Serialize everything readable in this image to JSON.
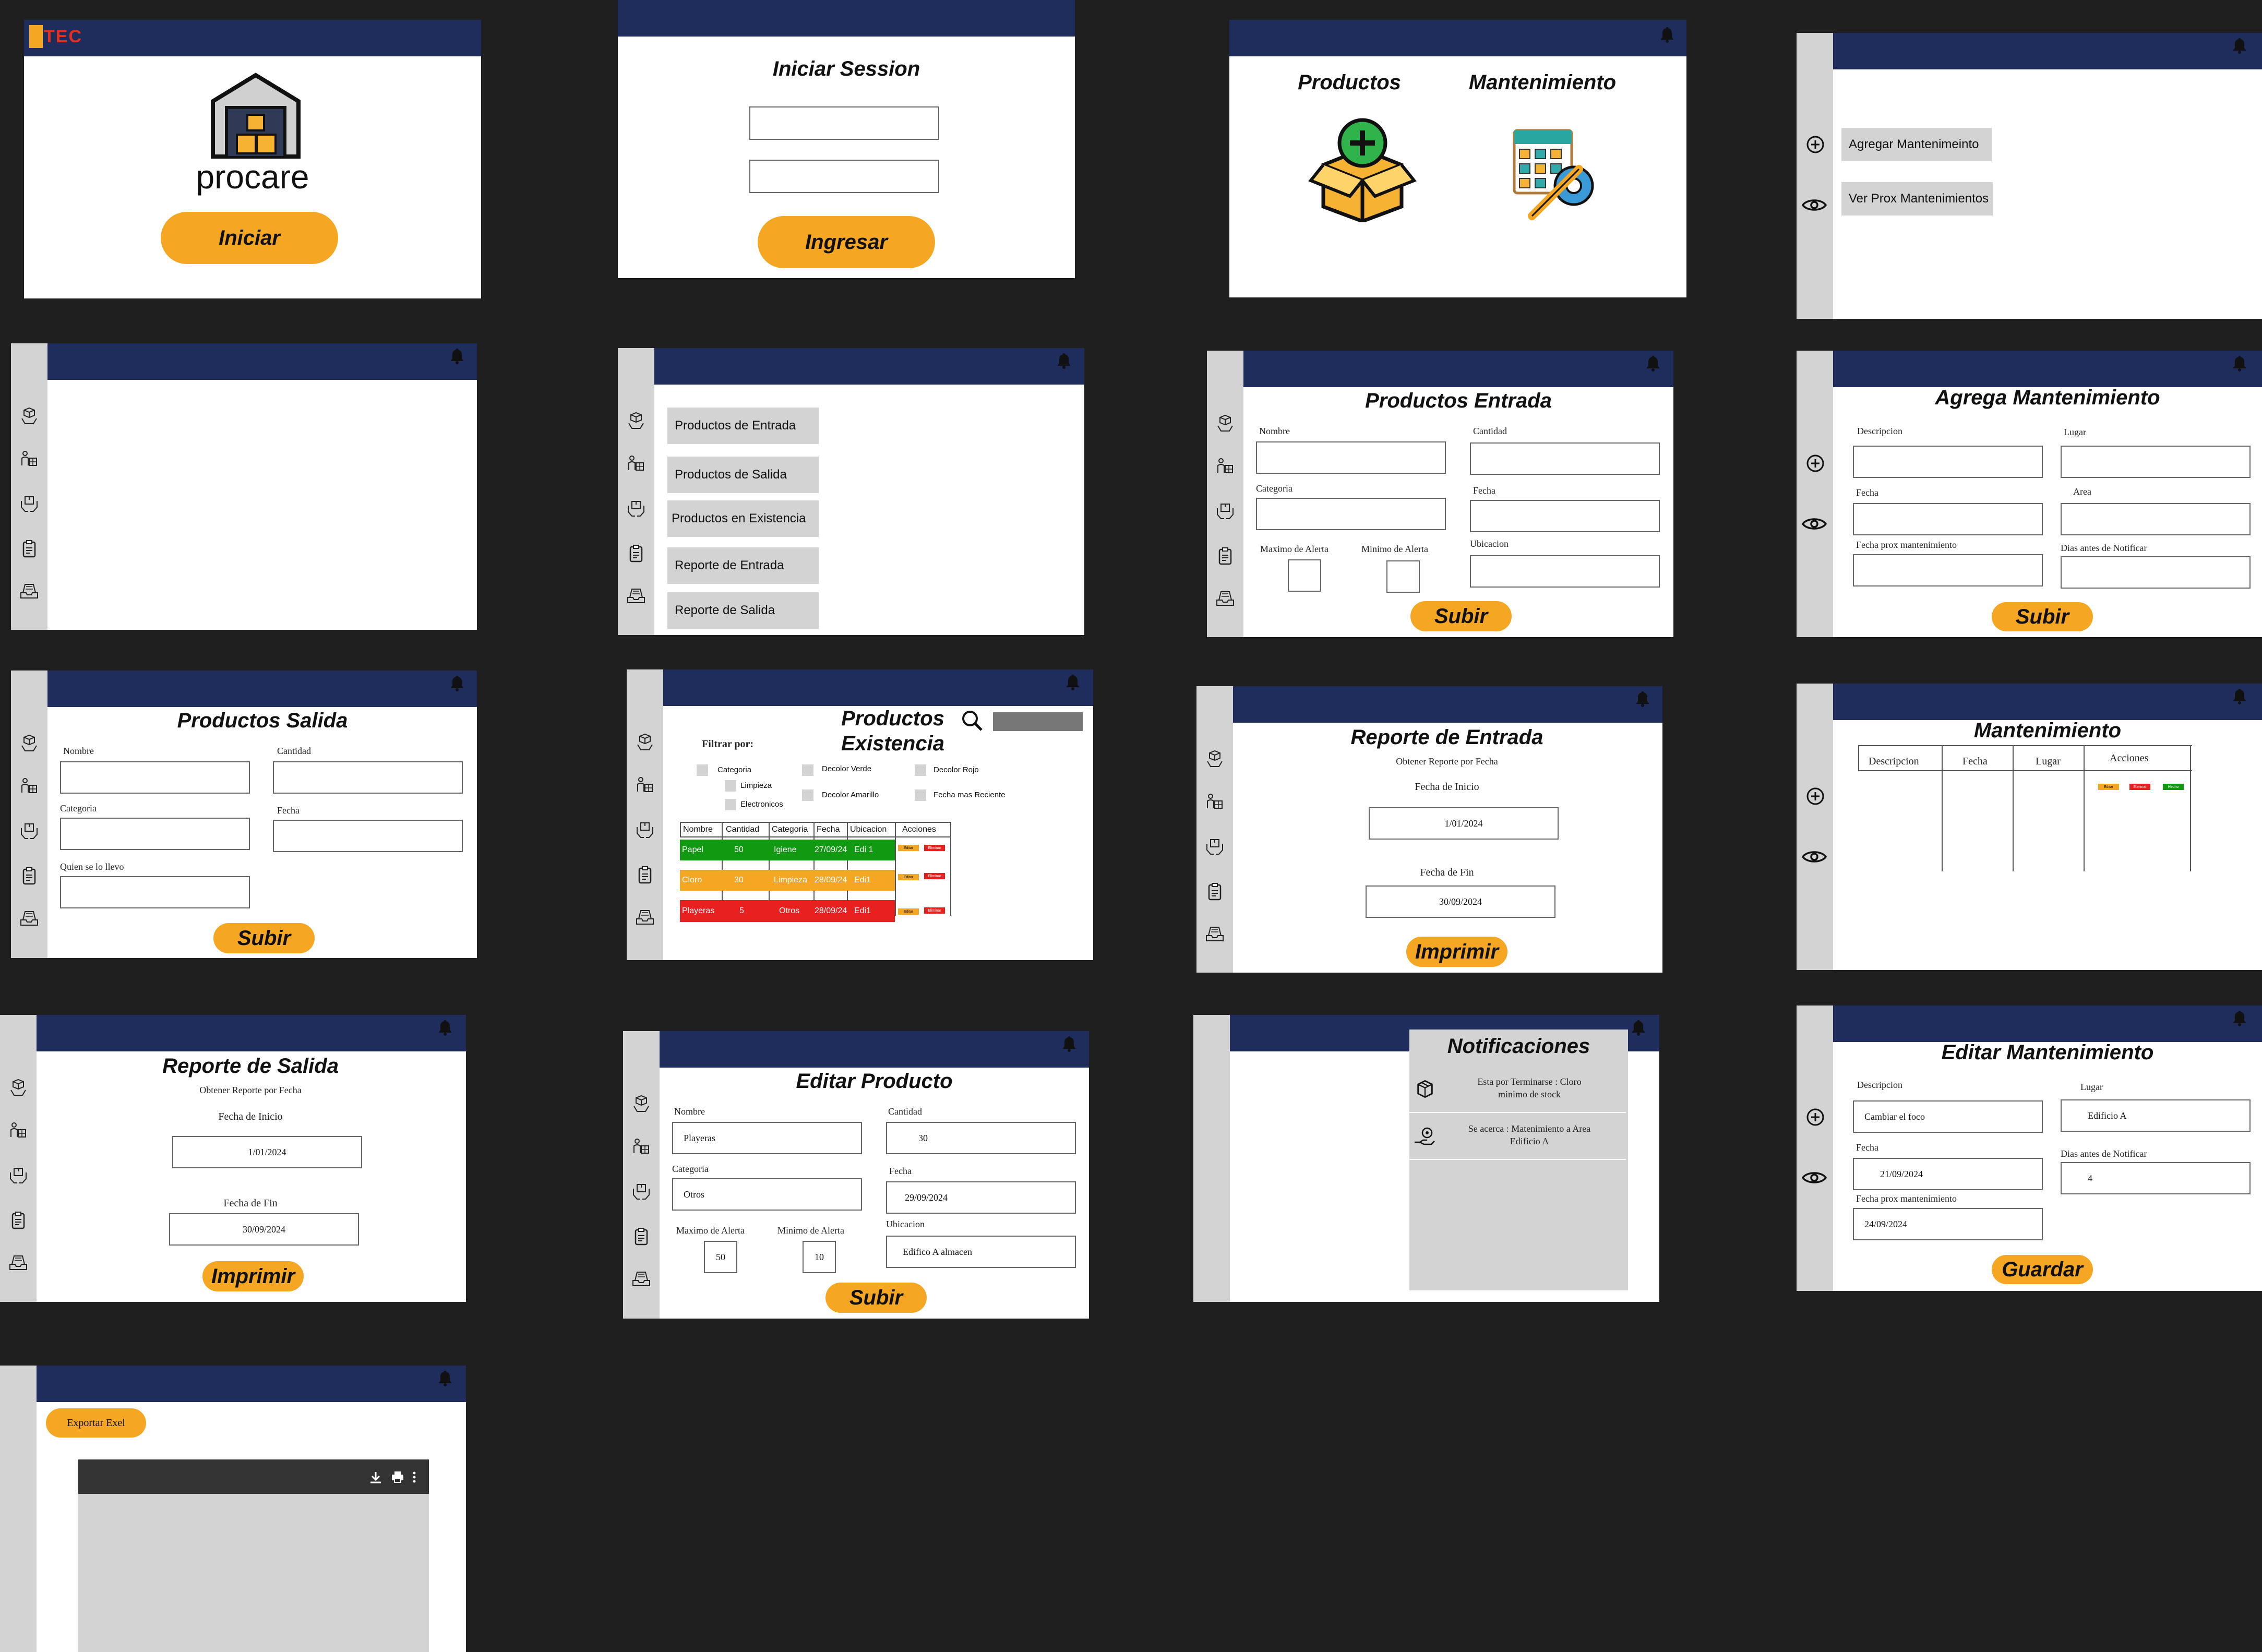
{
  "colors": {
    "navy": "#1e2d5c",
    "accent": "#f5a623",
    "sidebar": "#d3d3d3",
    "green": "#119911",
    "orange": "#f5a623",
    "red": "#e82020"
  },
  "splash": {
    "logo_text": "TEC",
    "brand": "procare",
    "start_label": "Iniciar"
  },
  "login": {
    "title": "Iniciar Session",
    "submit_label": "Ingresar"
  },
  "home": {
    "products_label": "Productos",
    "maintenance_label": "Mantenimiento"
  },
  "maint_menu": {
    "items": [
      {
        "label": "Agregar Mantenimeinto"
      },
      {
        "label": "Ver Prox Mantenimientos"
      }
    ]
  },
  "products_menu": {
    "items": [
      {
        "label": "Productos de Entrada"
      },
      {
        "label": "Productos de Salida"
      },
      {
        "label": "Productos en Existencia"
      },
      {
        "label": "Reporte de Entrada"
      },
      {
        "label": "Reporte de Salida"
      }
    ]
  },
  "prod_entrada": {
    "title": "Productos Entrada",
    "nombre": "Nombre",
    "cantidad": "Cantidad",
    "categoria": "Categoria",
    "fecha": "Fecha",
    "max_alerta": "Maximo de Alerta",
    "min_alerta": "Minimo de Alerta",
    "ubicacion": "Ubicacion",
    "submit": "Subir"
  },
  "agrega_mant": {
    "title": "Agrega Mantenimiento",
    "descripcion": "Descripcion",
    "lugar": "Lugar",
    "fecha": "Fecha",
    "area": "Area",
    "fecha_prox": "Fecha  prox mantenimiento",
    "dias": "Dias antes de Notificar",
    "submit": "Subir"
  },
  "prod_salida": {
    "title": "Productos Salida",
    "nombre": "Nombre",
    "cantidad": "Cantidad",
    "categoria": "Categoria",
    "fecha": "Fecha",
    "quien": "Quien se lo llevo",
    "submit": "Subir"
  },
  "existencia": {
    "title_1": "Productos",
    "title_2": "Existencia",
    "filter_label": "Filtrar por:",
    "filters": {
      "categoria": "Categoria",
      "limpieza": "Limpieza",
      "electronicos": "Electronicos",
      "verde": "Decolor  Verde",
      "amarillo": "Decolor Amarillo",
      "rojo": "Decolor  Rojo",
      "reciente": "Fecha mas Reciente"
    },
    "headers": [
      "Nombre",
      "Cantidad",
      "Categoria",
      "Fecha",
      "Ubicacion",
      "Acciones"
    ],
    "rows": [
      {
        "nombre": "Papel",
        "cantidad": "50",
        "categoria": "Igiene",
        "fecha": "27/09/24",
        "ubicacion": "Edi 1",
        "color": "#119911"
      },
      {
        "nombre": "Cloro",
        "cantidad": "30",
        "categoria": "Limpieza",
        "fecha": "28/09/24",
        "ubicacion": "Edi1",
        "color": "#f5a623"
      },
      {
        "nombre": "Playeras",
        "cantidad": "5",
        "categoria": "Otros",
        "fecha": "28/09/24",
        "ubicacion": "Edi1",
        "color": "#e82020"
      }
    ],
    "edit": "Editar",
    "delete": "Eliminar"
  },
  "reporte_entrada": {
    "title": "Reporte de Entrada",
    "subtitle": "Obtener Reporte por Fecha",
    "inicio_label": "Fecha de Inicio",
    "inicio": "1/01/2024",
    "fin_label": "Fecha de Fin",
    "fin": "30/09/2024",
    "submit": "Imprimir"
  },
  "mant_list": {
    "title": "Mantenimiento",
    "headers": [
      "Descripcion",
      "Fecha",
      "Lugar",
      "Acciones"
    ],
    "edit": "Editar",
    "delete": "Eliminar",
    "done": "Hecho"
  },
  "reporte_salida": {
    "title": "Reporte de Salida",
    "subtitle": "Obtener Reporte por Fecha",
    "inicio_label": "Fecha de Inicio",
    "inicio": "1/01/2024",
    "fin_label": "Fecha de Fin",
    "fin": "30/09/2024",
    "submit": "Imprimir"
  },
  "editar_producto": {
    "title": "Editar Producto",
    "nombre": "Nombre",
    "nombre_val": "Playeras",
    "cantidad": "Cantidad",
    "cantidad_val": "30",
    "categoria": "Categoria",
    "categoria_val": "Otros",
    "fecha": "Fecha",
    "fecha_val": "29/09/2024",
    "max_alerta": "Maximo de Alerta",
    "max_val": "50",
    "min_alerta": "Minimo de Alerta",
    "min_val": "10",
    "ubicacion": "Ubicacion",
    "ubicacion_val": "Edifico A almacen",
    "submit": "Subir"
  },
  "notificaciones": {
    "title": "Notificaciones",
    "items": [
      {
        "text_1": "Esta por Terminarse : Cloro",
        "text_2": "minimo de stock"
      },
      {
        "text_1": "Se acerca : Matenimiento a Area",
        "text_2": "Edificio A"
      }
    ]
  },
  "editar_mant": {
    "title": "Editar Mantenimiento",
    "descripcion": "Descripcion",
    "descripcion_val": "Cambiar el foco",
    "lugar": "Lugar",
    "lugar_val": "Edificio A",
    "fecha": "Fecha",
    "fecha_val": "21/09/2024",
    "dias": "Dias antes de Notificar",
    "dias_val": "4",
    "fecha_prox": "Fecha  prox mantenimiento",
    "fecha_prox_val": "24/09/2024",
    "submit": "Guardar"
  },
  "exportar": {
    "button": "Exportar Exel"
  }
}
